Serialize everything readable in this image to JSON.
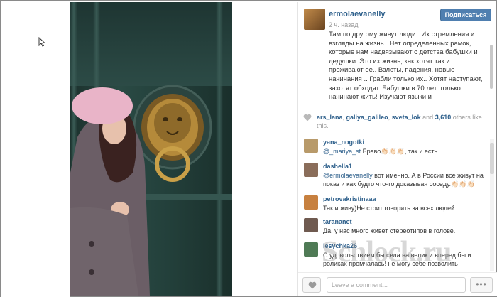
{
  "post": {
    "username": "ermolaevanelly",
    "time_ago": "2 ч. назад",
    "follow_label": "Подписаться",
    "caption": "Там по другому живут люди.. Их стремления и взгляды на жизнь.. Нет определенных рамок, которые нам надвязывают с детства бабушки и дедушки..Это их жизнь, как хотят так и проживают ее.. Взлеты, падения, новые начинания .. Грабли только их.. Хотят наступают, захотят обходят. Бабушки в 70 лет, только начинают жить! Изучают языки и"
  },
  "likes": {
    "user1": "ars_lana",
    "user2": "galiya_galileo",
    "user3": "sveta_lok",
    "and": "and",
    "count": "3,610",
    "others": "others like this."
  },
  "comments": [
    {
      "user": "yana_nogotki",
      "mention": "@_mariya_st",
      "text": " Браво👏🏻👏🏻👏🏻, так и есть",
      "avatar_color": "#b89a6a"
    },
    {
      "user": "dashella1",
      "mention": "@ermolaevanelly",
      "text": " вот именно. А в России все живут на показ и как будто что-то доказывая соседу.👏🏻👏🏻👏🏻",
      "avatar_color": "#8a6d5a"
    },
    {
      "user": "petrovakristinaaa",
      "mention": "",
      "text": "Так и живу)Не стоит говорить за всех людей",
      "avatar_color": "#c7803f"
    },
    {
      "user": "tarananet",
      "mention": "",
      "text": "Да, у нас много живет стереотипов в голове.",
      "avatar_color": "#6f5a50"
    },
    {
      "user": "lesychka26",
      "mention": "",
      "text": "С удовольствием бы села на велик и вперед бы и роликах промчалась! не могу себе позволить",
      "avatar_color": "#4f7a55"
    }
  ],
  "footer": {
    "comment_placeholder": "Leave a comment...",
    "more_label": "•••"
  },
  "watermark": "Schlock.ru",
  "colors": {
    "link": "#2d5f8b",
    "follow_button": "#4f7fb0"
  }
}
